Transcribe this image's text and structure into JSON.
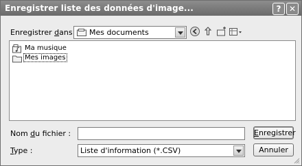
{
  "window": {
    "title": "Enregistrer liste des données d'image...",
    "help_glyph": "?",
    "close_glyph": "✕"
  },
  "look_in": {
    "label_pre": "Enregistrer ",
    "label_hot": "d",
    "label_post": "ans :",
    "value": "Mes documents"
  },
  "toolbar": {
    "back_icon": "back-icon",
    "up_icon": "up-folder-icon",
    "new_folder_icon": "new-folder-icon",
    "view_icon": "view-menu-icon"
  },
  "files": {
    "items": [
      {
        "name": "Ma musique",
        "icon": "music-folder-icon"
      },
      {
        "name": "Mes images",
        "icon": "folder-icon"
      }
    ]
  },
  "filename": {
    "label_pre": "Nom ",
    "label_hot": "d",
    "label_post": "u fichier :",
    "value": ""
  },
  "filetype": {
    "label_hot": "T",
    "label_post": "ype :",
    "value": "Liste d'information (*.CSV)"
  },
  "buttons": {
    "save_hot": "E",
    "save_rest": "nregistrer",
    "cancel": "Annuler"
  },
  "colors": {
    "titlebar": "#7a7a7a",
    "dialog_bg": "#ececec",
    "field_bg": "#ffffff"
  }
}
